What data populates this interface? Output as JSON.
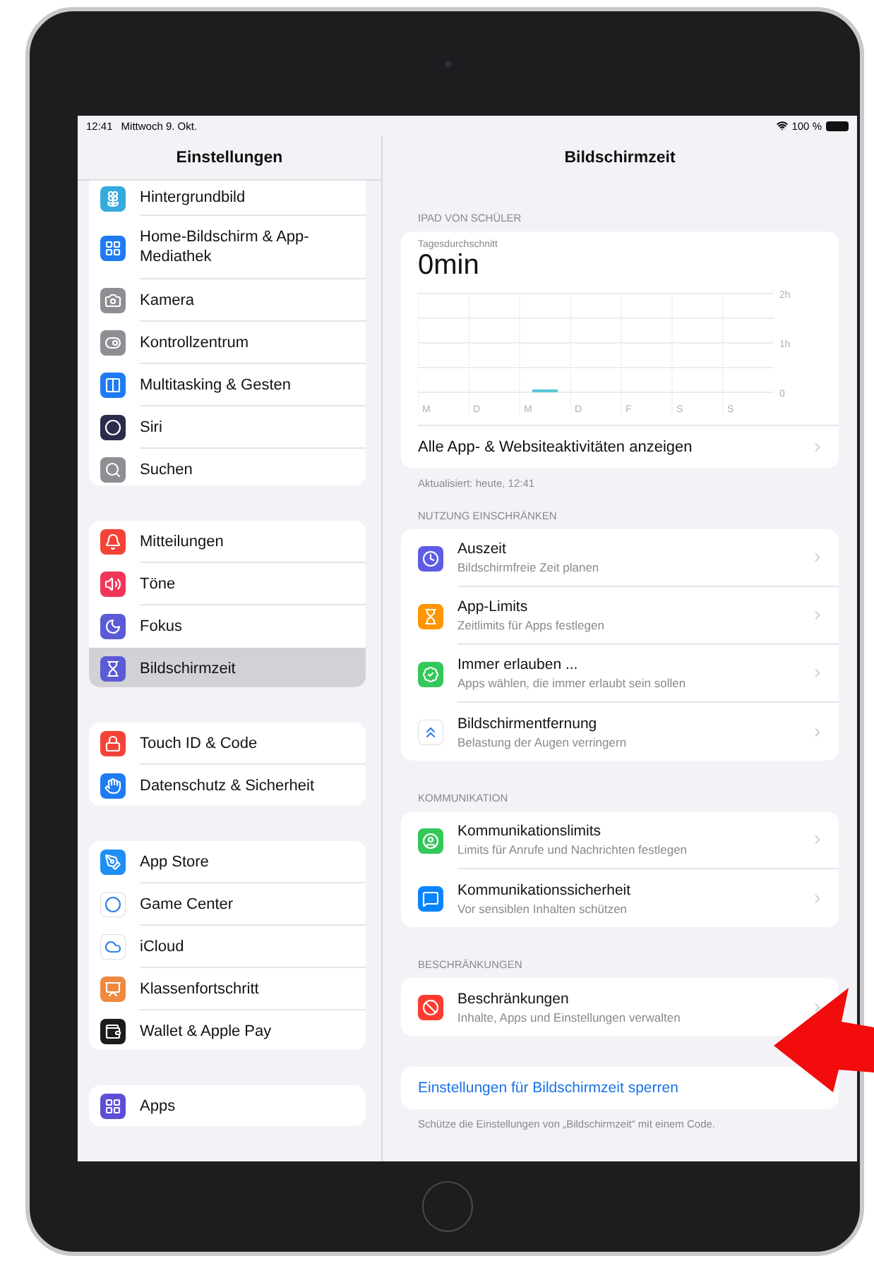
{
  "status_bar": {
    "time": "12:41",
    "date": "Mittwoch 9. Okt.",
    "battery": "100 %"
  },
  "sidebar": {
    "title": "Einstellungen",
    "groups": [
      {
        "items": [
          {
            "label": "Hintergrundbild",
            "color": "#35aadc",
            "selected": false
          },
          {
            "label": "Home-Bildschirm & App-Mediathek",
            "color": "#1e7bf2",
            "selected": false
          },
          {
            "label": "Kamera",
            "color": "#8e8e93",
            "selected": false
          },
          {
            "label": "Kontrollzentrum",
            "color": "#8e8e93",
            "selected": false
          },
          {
            "label": "Multitasking & Gesten",
            "color": "#1e7bf2",
            "selected": false
          },
          {
            "label": "Siri",
            "color": "#2b2b4a",
            "selected": false
          },
          {
            "label": "Suchen",
            "color": "#8e8e93",
            "selected": false
          }
        ]
      },
      {
        "items": [
          {
            "label": "Mitteilungen",
            "color": "#f44336",
            "selected": false
          },
          {
            "label": "Töne",
            "color": "#f2365a",
            "selected": false
          },
          {
            "label": "Fokus",
            "color": "#5b5bd6",
            "selected": false
          },
          {
            "label": "Bildschirmzeit",
            "color": "#5b5bd6",
            "selected": true
          }
        ]
      },
      {
        "items": [
          {
            "label": "Touch ID & Code",
            "color": "#f44336",
            "selected": false
          },
          {
            "label": "Datenschutz & Sicherheit",
            "color": "#1e7bf2",
            "selected": false
          }
        ]
      },
      {
        "items": [
          {
            "label": "App Store",
            "color": "#1e8ef5",
            "selected": false
          },
          {
            "label": "Game Center",
            "color": "#ffffff",
            "selected": false
          },
          {
            "label": "iCloud",
            "color": "#ffffff",
            "selected": false
          },
          {
            "label": "Klassenfortschritt",
            "color": "#f0883e",
            "selected": false
          },
          {
            "label": "Wallet & Apple Pay",
            "color": "#1c1c1e",
            "selected": false
          }
        ]
      },
      {
        "items": [
          {
            "label": "Apps",
            "color": "#5b4fd6",
            "selected": false
          }
        ]
      }
    ]
  },
  "detail": {
    "title": "Bildschirmzeit",
    "sections": [
      {
        "kind": "summary",
        "label": "IPAD VON SCHÜLER",
        "caption": "Tagesdurchschnitt",
        "value": "0min",
        "chart_data": {
          "type": "bar",
          "categories": [
            "M",
            "D",
            "M",
            "D",
            "F",
            "S",
            "S"
          ],
          "values": [
            0,
            0,
            0.03,
            0,
            0,
            0,
            0
          ],
          "ylim": [
            0,
            2
          ],
          "yticks": [
            {
              "value": 0,
              "label": "0"
            },
            {
              "value": 1,
              "label": "1h"
            },
            {
              "value": 2,
              "label": "2h"
            }
          ]
        },
        "link": "Alle App- & Websiteaktivitäten anzeigen",
        "footer": "Aktualisiert: heute, 12:41"
      },
      {
        "kind": "list",
        "label": "NUTZUNG EINSCHRÄNKEN",
        "rows": [
          {
            "title": "Auszeit",
            "subtitle": "Bildschirmfreie Zeit planen",
            "color": "#5e5ce6"
          },
          {
            "title": "App-Limits",
            "subtitle": "Zeitlimits für Apps festlegen",
            "color": "#ff9500"
          },
          {
            "title": "Immer erlauben ...",
            "subtitle": "Apps wählen, die immer erlaubt sein sollen",
            "color": "#34c759"
          },
          {
            "title": "Bildschirmentfernung",
            "subtitle": "Belastung der Augen verringern",
            "color": "#ffffff"
          }
        ]
      },
      {
        "kind": "list",
        "label": "KOMMUNIKATION",
        "rows": [
          {
            "title": "Kommunikationslimits",
            "subtitle": "Limits für Anrufe und Nachrichten festlegen",
            "color": "#34c759"
          },
          {
            "title": "Kommunikationssicherheit",
            "subtitle": "Vor sensiblen Inhalten schützen",
            "color": "#0a84ff"
          }
        ]
      },
      {
        "kind": "list",
        "label": "BESCHRÄNKUNGEN",
        "rows": [
          {
            "title": "Beschränkungen",
            "subtitle": "Inhalte, Apps und Einstellungen verwalten",
            "color": "#ff3b30"
          }
        ]
      },
      {
        "kind": "action",
        "link": "Einstellungen für Bildschirmzeit sperren",
        "footer": "Schütze die Einstellungen von „Bildschirmzeit“ mit einem Code."
      }
    ]
  }
}
